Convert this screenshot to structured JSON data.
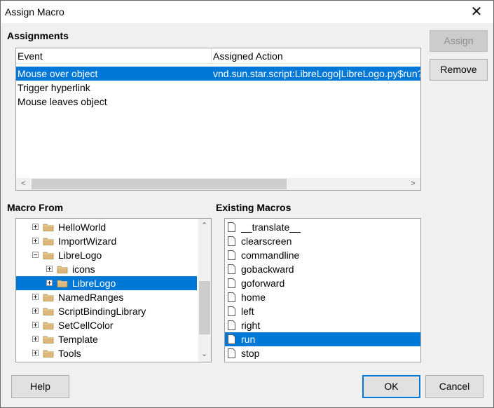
{
  "window": {
    "title": "Assign Macro",
    "close_glyph": "✕"
  },
  "assignments": {
    "label": "Assignments",
    "columns": [
      "Event",
      "Assigned Action"
    ],
    "rows": [
      {
        "event": "Mouse over object",
        "action": "vnd.sun.star.script:LibreLogo|LibreLogo.py$run?language=Python&location=share",
        "selected": true
      },
      {
        "event": "Trigger hyperlink",
        "action": "",
        "selected": false
      },
      {
        "event": "Mouse leaves object",
        "action": "",
        "selected": false
      }
    ]
  },
  "buttons": {
    "assign": "Assign",
    "remove": "Remove",
    "help": "Help",
    "ok": "OK",
    "cancel": "Cancel"
  },
  "macro_from": {
    "label": "Macro From",
    "items": [
      {
        "label": "HelloWorld",
        "expanded": false,
        "selected": false
      },
      {
        "label": "ImportWizard",
        "expanded": false,
        "selected": false
      },
      {
        "label": "LibreLogo",
        "expanded": true,
        "selected": false
      },
      {
        "label": "icons",
        "expanded": false,
        "selected": false
      },
      {
        "label": "LibreLogo",
        "expanded": false,
        "selected": true
      },
      {
        "label": "NamedRanges",
        "expanded": false,
        "selected": false
      },
      {
        "label": "ScriptBindingLibrary",
        "expanded": false,
        "selected": false
      },
      {
        "label": "SetCellColor",
        "expanded": false,
        "selected": false
      },
      {
        "label": "Template",
        "expanded": false,
        "selected": false
      },
      {
        "label": "Tools",
        "expanded": false,
        "selected": false
      }
    ]
  },
  "existing_macros": {
    "label": "Existing Macros",
    "items": [
      "__translate__",
      "clearscreen",
      "commandline",
      "gobackward",
      "goforward",
      "home",
      "left",
      "right",
      "run",
      "stop"
    ],
    "selected": "run"
  },
  "colors": {
    "selection": "#0078d7",
    "default_button_border": "#0078d7"
  },
  "icons": {
    "close": "close-icon",
    "expander": "plus-box-icon",
    "folder": "folder-icon",
    "macro": "document-icon"
  }
}
